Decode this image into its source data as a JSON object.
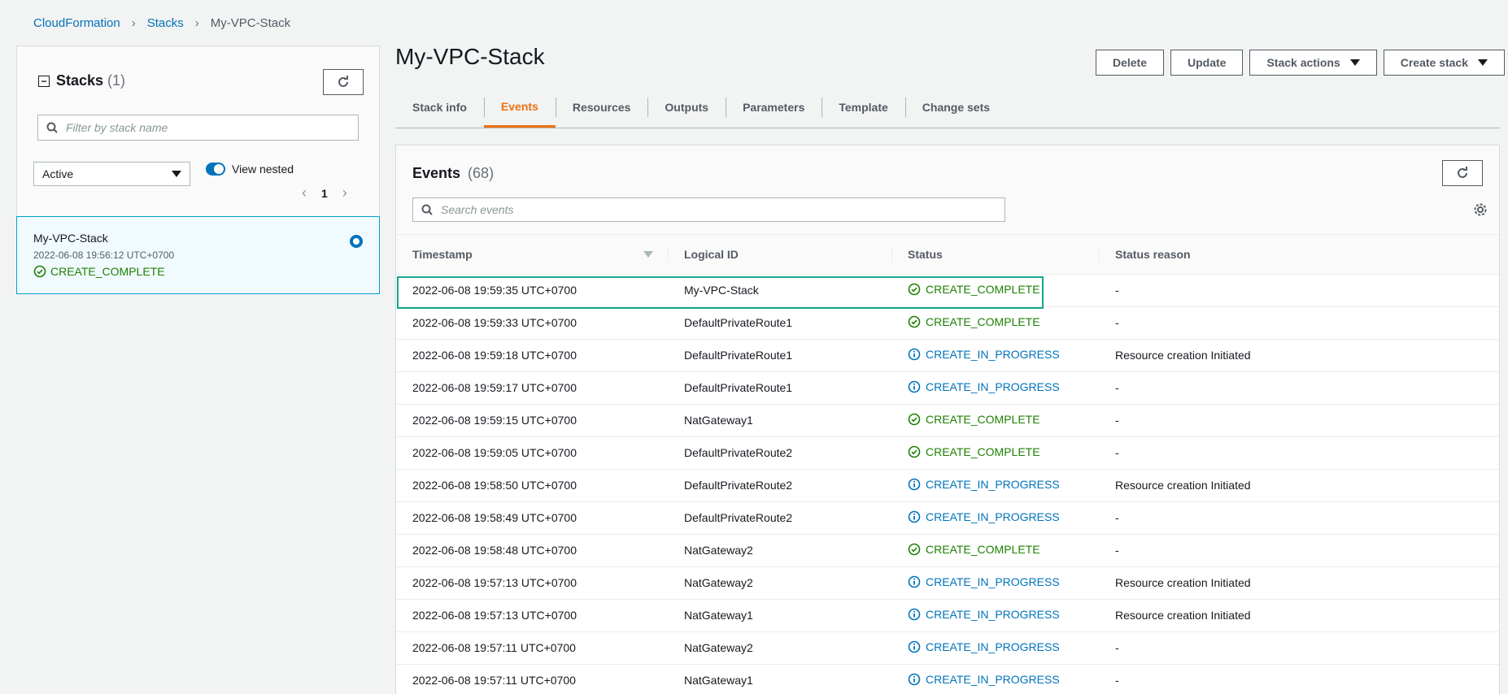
{
  "breadcrumb": {
    "items": [
      "CloudFormation",
      "Stacks"
    ],
    "current": "My-VPC-Stack"
  },
  "left_panel": {
    "title": "Stacks",
    "count": "(1)",
    "filter_placeholder": "Filter by stack name",
    "status_filter": "Active",
    "view_nested_label": "View nested",
    "page": "1",
    "stack": {
      "name": "My-VPC-Stack",
      "created": "2022-06-08 19:56:12 UTC+0700",
      "status": "CREATE_COMPLETE"
    }
  },
  "page_title": "My-VPC-Stack",
  "actions": {
    "delete": "Delete",
    "update": "Update",
    "stack_actions": "Stack actions",
    "create_stack": "Create stack"
  },
  "tabs": [
    "Stack info",
    "Events",
    "Resources",
    "Outputs",
    "Parameters",
    "Template",
    "Change sets"
  ],
  "active_tab": "Events",
  "events": {
    "title": "Events",
    "count": "(68)",
    "search_placeholder": "Search events",
    "columns": [
      "Timestamp",
      "Logical ID",
      "Status",
      "Status reason"
    ],
    "rows": [
      [
        "2022-06-08 19:59:35 UTC+0700",
        "My-VPC-Stack",
        "CREATE_COMPLETE",
        "-"
      ],
      [
        "2022-06-08 19:59:33 UTC+0700",
        "DefaultPrivateRoute1",
        "CREATE_COMPLETE",
        "-"
      ],
      [
        "2022-06-08 19:59:18 UTC+0700",
        "DefaultPrivateRoute1",
        "CREATE_IN_PROGRESS",
        "Resource creation Initiated"
      ],
      [
        "2022-06-08 19:59:17 UTC+0700",
        "DefaultPrivateRoute1",
        "CREATE_IN_PROGRESS",
        "-"
      ],
      [
        "2022-06-08 19:59:15 UTC+0700",
        "NatGateway1",
        "CREATE_COMPLETE",
        "-"
      ],
      [
        "2022-06-08 19:59:05 UTC+0700",
        "DefaultPrivateRoute2",
        "CREATE_COMPLETE",
        "-"
      ],
      [
        "2022-06-08 19:58:50 UTC+0700",
        "DefaultPrivateRoute2",
        "CREATE_IN_PROGRESS",
        "Resource creation Initiated"
      ],
      [
        "2022-06-08 19:58:49 UTC+0700",
        "DefaultPrivateRoute2",
        "CREATE_IN_PROGRESS",
        "-"
      ],
      [
        "2022-06-08 19:58:48 UTC+0700",
        "NatGateway2",
        "CREATE_COMPLETE",
        "-"
      ],
      [
        "2022-06-08 19:57:13 UTC+0700",
        "NatGateway2",
        "CREATE_IN_PROGRESS",
        "Resource creation Initiated"
      ],
      [
        "2022-06-08 19:57:13 UTC+0700",
        "NatGateway1",
        "CREATE_IN_PROGRESS",
        "Resource creation Initiated"
      ],
      [
        "2022-06-08 19:57:11 UTC+0700",
        "NatGateway2",
        "CREATE_IN_PROGRESS",
        "-"
      ],
      [
        "2022-06-08 19:57:11 UTC+0700",
        "NatGateway1",
        "CREATE_IN_PROGRESS",
        "-"
      ]
    ]
  },
  "colors": {
    "link": "#0073bb",
    "success": "#1d8102",
    "info": "#0073bb",
    "active_tab": "#ec7211",
    "highlight": "#16a78f"
  }
}
